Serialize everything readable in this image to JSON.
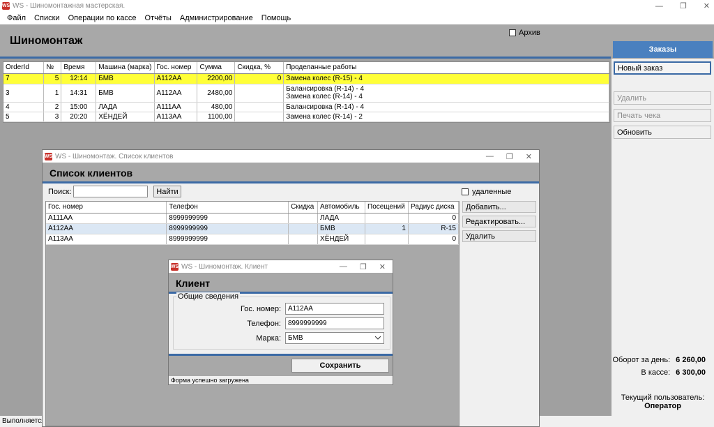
{
  "window": {
    "title": "WS - Шиномонтажная мастерская.",
    "app_icon_text": "WS",
    "minimize": "—",
    "maximize": "❐",
    "close": "✕"
  },
  "menu": [
    "Файл",
    "Списки",
    "Операции по кассе",
    "Отчёты",
    "Администрирование",
    "Помощь"
  ],
  "header": {
    "title": "Шиномонтаж",
    "archive_label": "Архив"
  },
  "orders_tab": "Заказы",
  "orders": {
    "columns": [
      "OrderId",
      "№",
      "Время",
      "Машина (марка)",
      "Гос. номер",
      "Сумма",
      "Скидка, %",
      "Проделанные работы"
    ],
    "rows": [
      {
        "id": "7",
        "num": "5",
        "time": "12:14",
        "car": "БМВ",
        "plate": "А112АА",
        "sum": "2200,00",
        "discount": "0",
        "works": [
          "Замена колес (R-15) - 4"
        ],
        "selected": true
      },
      {
        "id": "3",
        "num": "1",
        "time": "14:31",
        "car": "БМВ",
        "plate": "А112АА",
        "sum": "2480,00",
        "discount": "",
        "works": [
          "Балансировка (R-14) - 4",
          "Замена колес (R-14) - 4"
        ],
        "selected": false
      },
      {
        "id": "4",
        "num": "2",
        "time": "15:00",
        "car": "ЛАДА",
        "plate": "А111АА",
        "sum": "480,00",
        "discount": "",
        "works": [
          "Балансировка (R-14) - 4"
        ],
        "selected": false
      },
      {
        "id": "5",
        "num": "3",
        "time": "20:20",
        "car": "ХЁНДЕЙ",
        "plate": "А113АА",
        "sum": "1100,00",
        "discount": "",
        "works": [
          "Замена колес (R-14) - 2"
        ],
        "selected": false
      }
    ]
  },
  "side": {
    "new_order": "Новый заказ",
    "delete": "Удалить",
    "print_receipt": "Печать чека",
    "refresh": "Обновить",
    "turnover_label": "Оборот за день:",
    "turnover_value": "6 260,00",
    "cash_label": "В кассе:",
    "cash_value": "6 300,00",
    "user_label": "Текущий пользователь:",
    "user_value": "Оператор"
  },
  "status": "Выполняется к",
  "clients_dialog": {
    "title": "WS - Шиномонтаж. Список клиентов",
    "header": "Список клиентов",
    "search_label": "Поиск:",
    "search_value": "",
    "find_button": "Найти",
    "deleted_label": "удаленные",
    "columns": [
      "Гос. номер",
      "Телефон",
      "Скидка",
      "Автомобиль",
      "Посещений",
      "Радиус диска"
    ],
    "rows": [
      {
        "plate": "А111АА",
        "phone": "8999999999",
        "discount": "",
        "car": "ЛАДА",
        "visits": "",
        "radius": "0",
        "selected": false
      },
      {
        "plate": "А112АА",
        "phone": "8999999999",
        "discount": "",
        "car": "БМВ",
        "visits": "1",
        "radius": "R-15",
        "selected": true
      },
      {
        "plate": "А113АА",
        "phone": "8999999999",
        "discount": "",
        "car": "ХЁНДЕЙ",
        "visits": "",
        "radius": "0",
        "selected": false
      }
    ],
    "add_button": "Добавить...",
    "edit_button": "Редактировать...",
    "delete_button": "Удалить"
  },
  "client_dialog": {
    "title": "WS - Шиномонтаж. Клиент",
    "header": "Клиент",
    "group_label": "Общие сведения",
    "plate_label": "Гос. номер:",
    "plate_value": "А112АА",
    "phone_label": "Телефон:",
    "phone_value": "8999999999",
    "brand_label": "Марка:",
    "brand_value": "БМВ",
    "save_button": "Сохранить",
    "status": "Форма успешно загружена"
  },
  "colors": {
    "accent": "#3b6aa5",
    "selection": "#ffff38",
    "tab": "#4a80bf"
  }
}
